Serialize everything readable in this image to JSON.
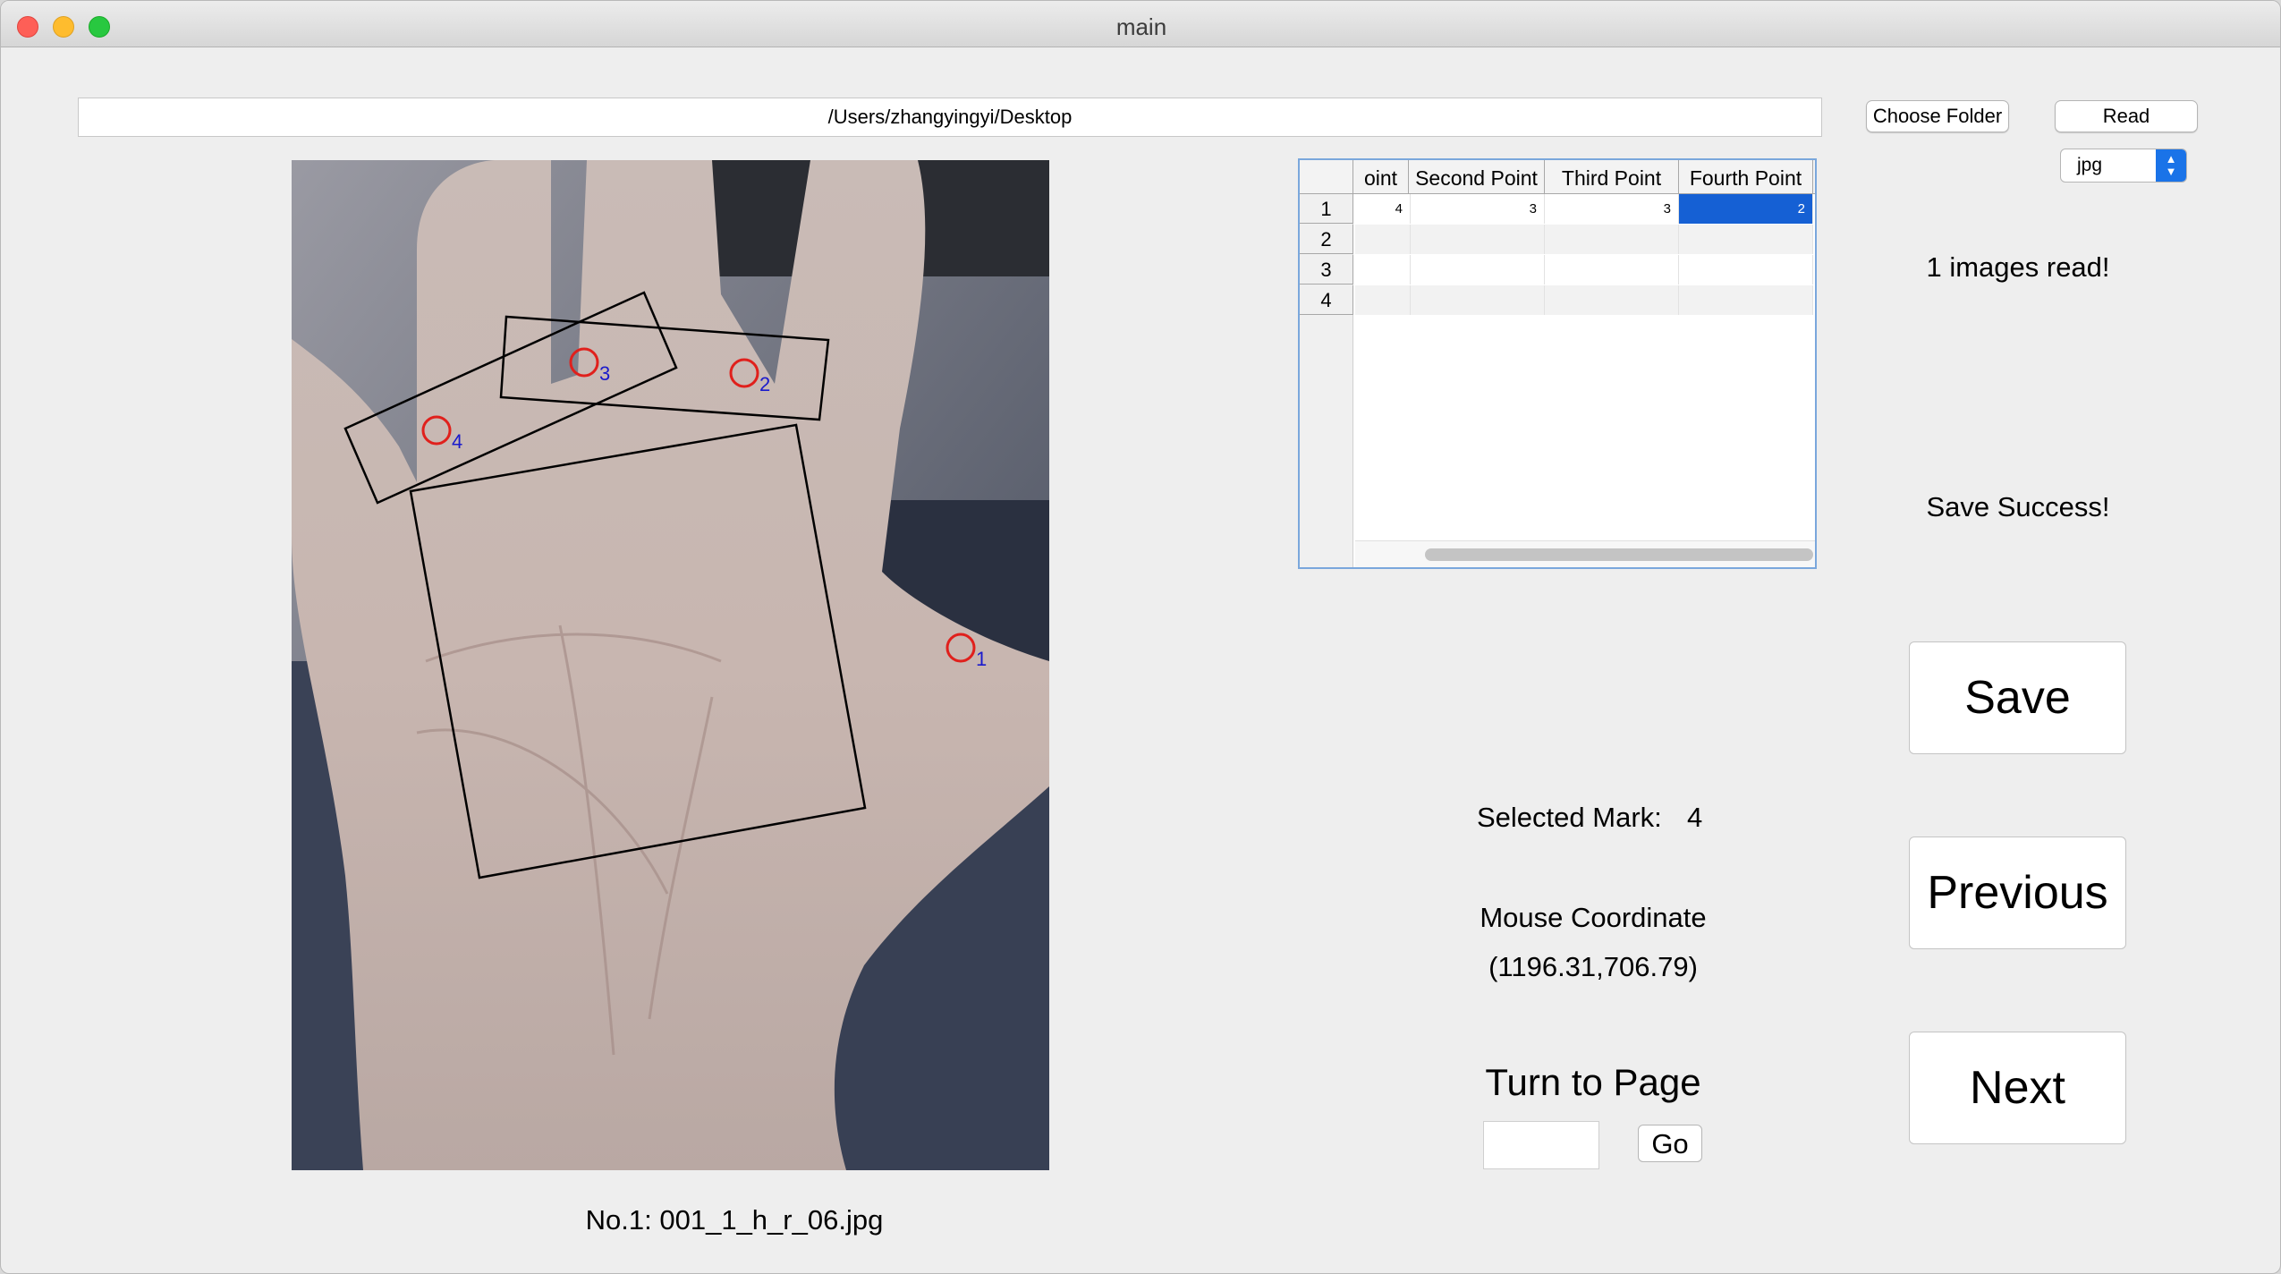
{
  "window": {
    "title": "main"
  },
  "folder": {
    "path": "/Users/zhangyingyi/Desktop",
    "choose_label": "Choose Folder",
    "read_label": "Read"
  },
  "file_type": {
    "selected": "jpg"
  },
  "table": {
    "headers": [
      "oint",
      "Second Point",
      "Third Point",
      "Fourth Point"
    ],
    "rows": [
      {
        "num": "1",
        "cells": [
          "4",
          "3",
          "3",
          "2"
        ]
      },
      {
        "num": "2",
        "cells": [
          "",
          "",
          "",
          ""
        ]
      },
      {
        "num": "3",
        "cells": [
          "",
          "",
          "",
          ""
        ]
      },
      {
        "num": "4",
        "cells": [
          "",
          "",
          "",
          ""
        ]
      }
    ],
    "selected_color": "#1560d4"
  },
  "status": {
    "images_read": "1 images read!",
    "save": "Save Success!"
  },
  "buttons": {
    "save": "Save",
    "previous": "Previous",
    "next": "Next",
    "go": "Go"
  },
  "selection": {
    "label": "Selected Mark:",
    "value": "4"
  },
  "mouse": {
    "label": "Mouse Coordinate",
    "value": "(1196.31,706.79)"
  },
  "page_nav": {
    "label": "Turn to Page",
    "input_value": ""
  },
  "image": {
    "caption": "No.1: 001_1_h_r_06.jpg",
    "markers": [
      {
        "label": "1"
      },
      {
        "label": "2"
      },
      {
        "label": "3"
      },
      {
        "label": "4"
      }
    ],
    "marker_color": "#e0201c",
    "label_color": "#1a1acc",
    "box_color": "#000000"
  }
}
